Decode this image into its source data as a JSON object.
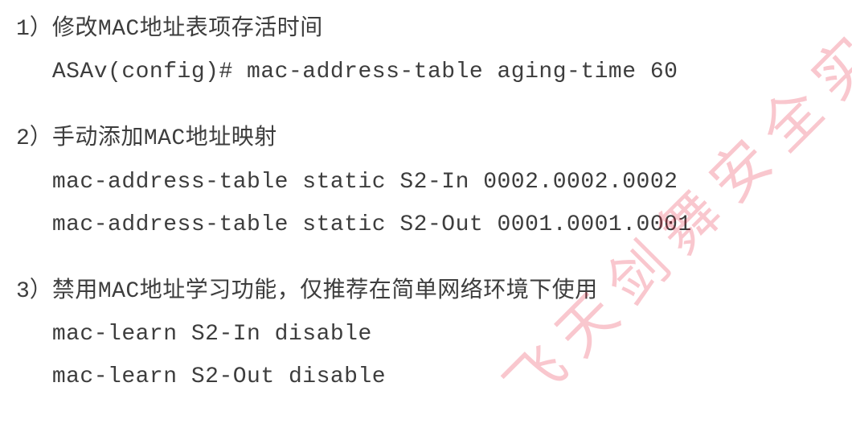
{
  "items": [
    {
      "num": "1）",
      "title": "修改MAC地址表项存活时间",
      "lines": [
        "ASAv(config)# mac-address-table aging-time 60"
      ]
    },
    {
      "num": "2）",
      "title": "手动添加MAC地址映射",
      "lines": [
        "mac-address-table static S2-In 0002.0002.0002",
        "mac-address-table static S2-Out 0001.0001.0001"
      ]
    },
    {
      "num": "3）",
      "title": "禁用MAC地址学习功能，仅推荐在简单网络环境下使用",
      "lines": [
        "mac-learn S2-In disable",
        "mac-learn S2-Out disable"
      ]
    }
  ],
  "watermark": "飞天剑舞安全实"
}
